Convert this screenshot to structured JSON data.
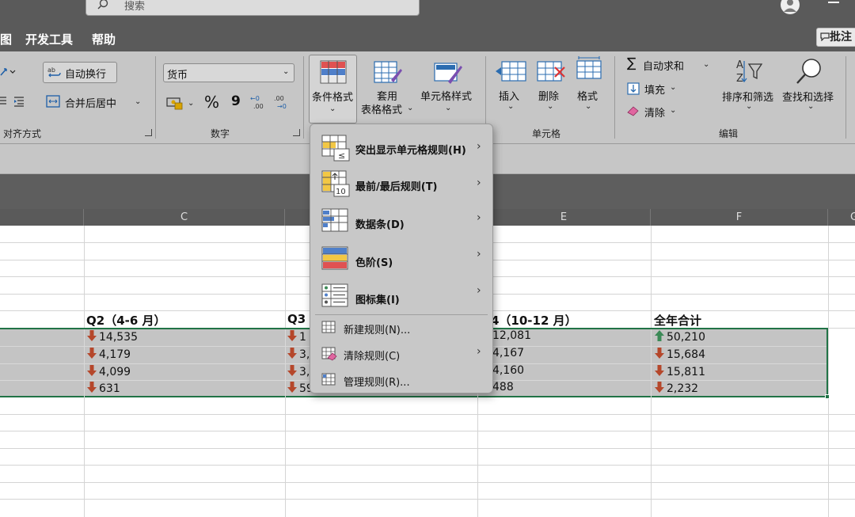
{
  "search": {
    "placeholder": "搜索"
  },
  "tabs": [
    {
      "label": "图"
    },
    {
      "label": "开发工具"
    },
    {
      "label": "帮助"
    }
  ],
  "comment_button": {
    "label": "批注"
  },
  "ribbon": {
    "alignment": {
      "wrap_text": "自动换行",
      "merge_center": "合并后居中",
      "group_label": "对齐方式"
    },
    "number": {
      "format_value": "货币",
      "percent_symbol": "%",
      "comma_symbol": "9",
      "group_label": "数字"
    },
    "styles": {
      "conditional_formatting": "条件格式",
      "format_as_table_line1": "套用",
      "format_as_table_line2": "表格格式",
      "cell_styles": "单元格样式"
    },
    "cells": {
      "insert": "插入",
      "delete": "删除",
      "format": "格式",
      "group_label": "单元格"
    },
    "editing": {
      "autosum": "自动求和",
      "fill": "填充",
      "clear": "清除",
      "sort_filter": "排序和筛选",
      "find_select": "查找和选择",
      "group_label": "编辑"
    }
  },
  "columns": [
    {
      "label": "C"
    },
    {
      "label": "E"
    },
    {
      "label": "F"
    },
    {
      "label": "G"
    }
  ],
  "table": {
    "headers": {
      "q2": "Q2（4-6 月）",
      "q3": "Q3",
      "q4": "4（10-12 月）",
      "total": "全年合计"
    },
    "rows": [
      {
        "q2": "14,535",
        "q3": "1",
        "q4": "12,081",
        "total": "50,210",
        "total_trend": "up"
      },
      {
        "q2": "4,179",
        "q3": "3,",
        "q4": "4,167",
        "total": "15,684",
        "total_trend": "down"
      },
      {
        "q2": "4,099",
        "q3": "3,",
        "q4": "4,160",
        "total": "15,811",
        "total_trend": "down"
      },
      {
        "q2": "631",
        "q3": "59",
        "q4": "488",
        "total": "2,232",
        "total_trend": "down"
      }
    ]
  },
  "menu": {
    "items": [
      {
        "label": "突出显示单元格规则(H)",
        "icon": "highlight-rules-icon",
        "submenu": true
      },
      {
        "label": "最前/最后规则(T)",
        "icon": "top-bottom-rules-icon",
        "submenu": true
      },
      {
        "label": "数据条(D)",
        "icon": "data-bars-icon",
        "submenu": true
      },
      {
        "label": "色阶(S)",
        "icon": "color-scales-icon",
        "submenu": true
      },
      {
        "label": "图标集(I)",
        "icon": "icon-sets-icon",
        "submenu": true
      }
    ],
    "actions": [
      {
        "label": "新建规则(N)...",
        "icon": "new-rule-icon",
        "submenu": false
      },
      {
        "label": "清除规则(C)",
        "icon": "clear-rules-icon",
        "submenu": true
      },
      {
        "label": "管理规则(R)...",
        "icon": "manage-rules-icon",
        "submenu": false
      }
    ],
    "highlight_icon_symbol": "≤",
    "topbottom_icon_number": "10"
  },
  "colors": {
    "selection_border": "#217346",
    "down_arrow": "#b5472b",
    "up_arrow": "#3c8a57"
  }
}
